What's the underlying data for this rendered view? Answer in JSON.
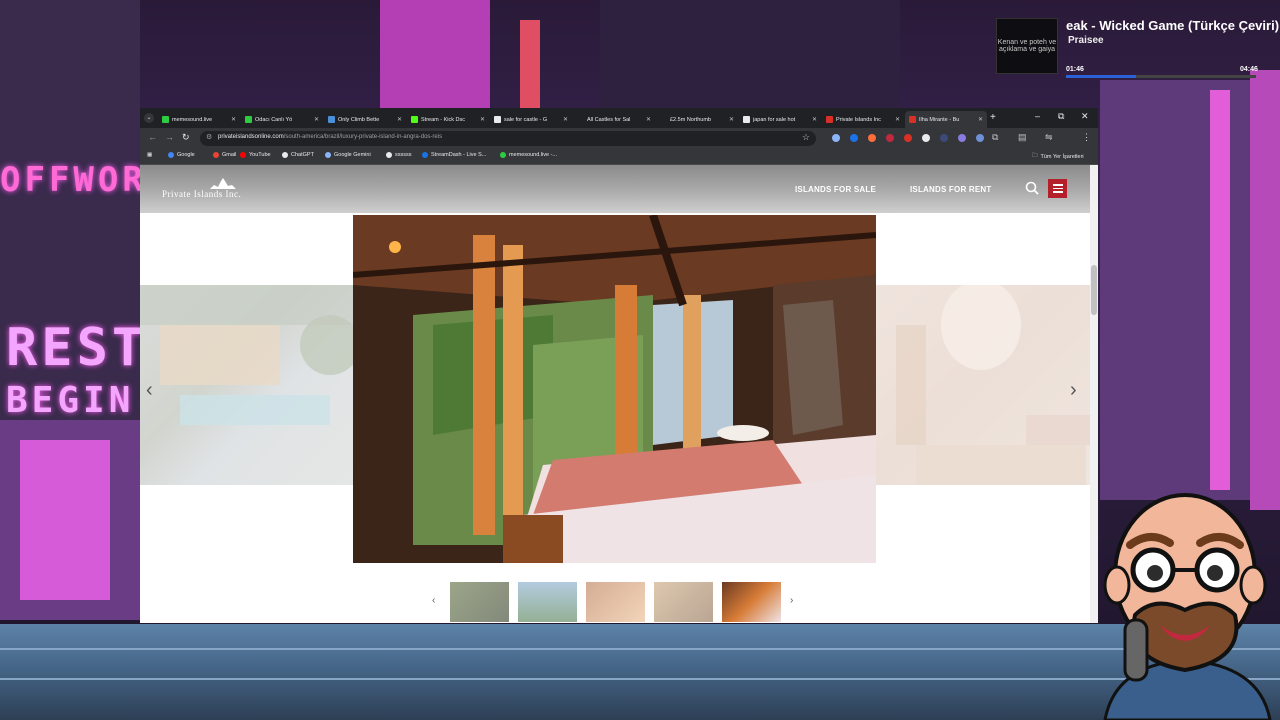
{
  "music": {
    "title": "eak - Wicked Game (Türkçe Çeviri)",
    "artist": "Praisee",
    "time_current": "01:46",
    "time_total": "04:46",
    "progress_fraction": 0.37,
    "art_caption": "Kenan ve poteh ve açıklama ve gaiya"
  },
  "tabs": [
    {
      "label": "memesound.live",
      "color": "#2ecc40"
    },
    {
      "label": "Odacı Canlı Yö",
      "color": "#2ecc40"
    },
    {
      "label": "Only Climb Bette",
      "color": "#4a90d9"
    },
    {
      "label": "Stream - Kick Dsc",
      "color": "#53fc18"
    },
    {
      "label": "sale for castle - G",
      "color": "#e8eaed"
    },
    {
      "label": "All Castles for Sal",
      "color": "#202124"
    },
    {
      "label": "£2.5m Northumb",
      "color": "#202124"
    },
    {
      "label": "japan for sale hot",
      "color": "#e8eaed"
    },
    {
      "label": "Private Islands Inc",
      "color": "#d93025"
    },
    {
      "label": "Ilha Mirante - Bu",
      "color": "#d93025"
    }
  ],
  "address": {
    "domain": "privateislandsonline.com",
    "path": "/south-america/brazil/luxury-private-island-in-angra-dos-reis"
  },
  "bookmarks": [
    {
      "label": "Google",
      "color": "#4285f4"
    },
    {
      "label": "Gmail",
      "color": "#ea4335"
    },
    {
      "label": "YouTube",
      "color": "#ff0000"
    },
    {
      "label": "ChatGPT",
      "color": "#e8eaed"
    },
    {
      "label": "Google Gemini",
      "color": "#8ab4f8"
    },
    {
      "label": "ssssss",
      "color": "#e8eaed"
    },
    {
      "label": "StreamDash - Live S...",
      "color": "#1a73e8"
    },
    {
      "label": "memesound.live -...",
      "color": "#2ecc40"
    }
  ],
  "bookmarks_all": "Tüm Yer İşaretleri",
  "site": {
    "logo": "Private Islands Inc.",
    "nav": [
      "ISLANDS FOR SALE",
      "ISLANDS FOR RENT"
    ],
    "accent": "#b4202a"
  },
  "gallery": {
    "prev_icon": "chevron-left",
    "next_icon": "chevron-right",
    "thumbnail_count": 5,
    "active_thumbnail": 5
  },
  "stream": {
    "sign_top": "OFFWOR",
    "sign_mid": "REST",
    "sign_bot": "BEGIN"
  }
}
